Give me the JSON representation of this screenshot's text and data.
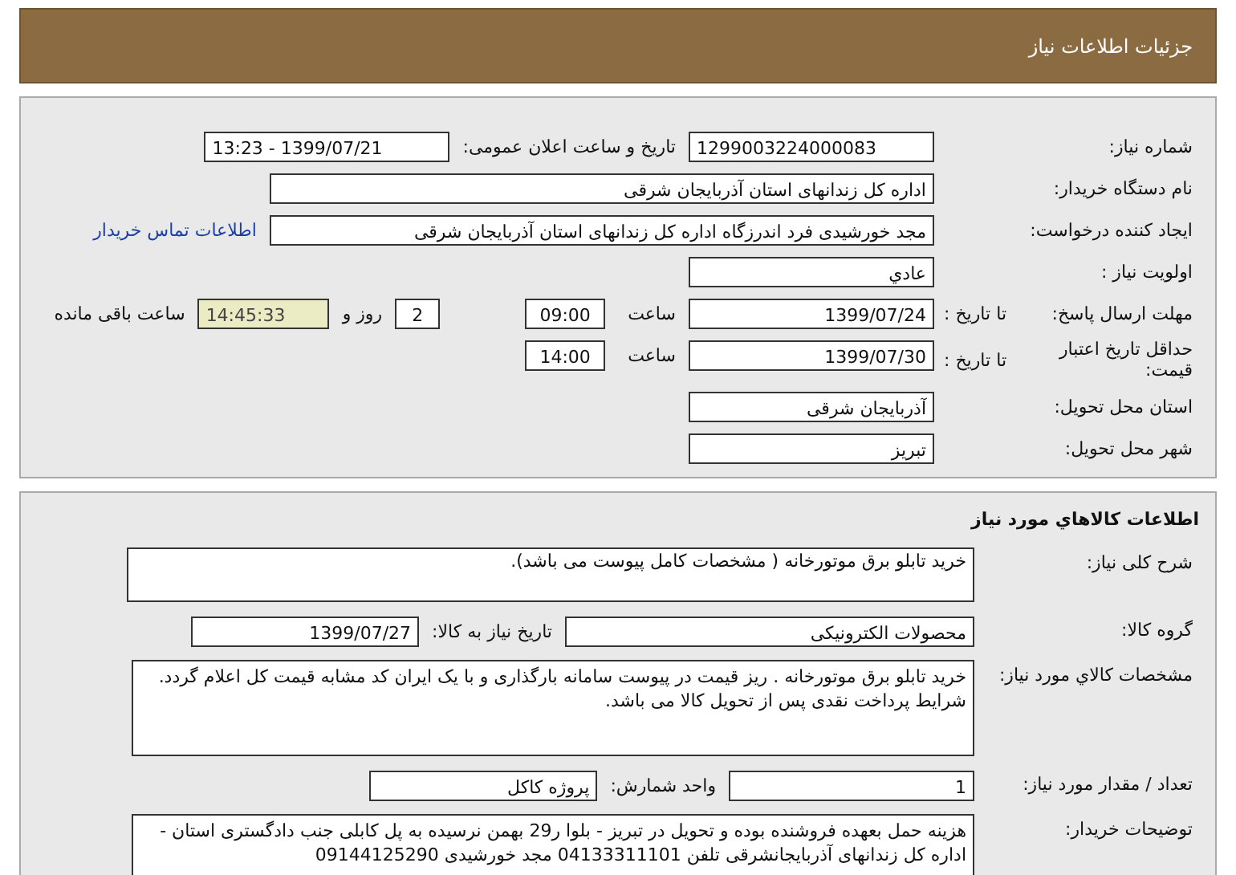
{
  "title": "جزئیات اطلاعات نیاز",
  "sections": [
    {
      "rows": [
        {
          "label": "شماره نیاز:",
          "items": [
            {
              "kind": "field",
              "value": "1299003224000083"
            },
            {
              "kind": "text",
              "value": "تاریخ و ساعت اعلان عمومی:"
            },
            {
              "kind": "field",
              "value": "1399/07/21 - 13:23"
            }
          ]
        },
        {
          "label": "نام دستگاه خریدار:",
          "items": [
            {
              "kind": "wide",
              "value": "اداره کل زندانهای استان آذربایجان شرقی"
            }
          ]
        },
        {
          "label": "ایجاد کننده درخواست:",
          "items": [
            {
              "kind": "wide",
              "value": "مجد خورشیدی فرد اندرزگاه اداره کل زندانهای استان آذربایجان شرقی"
            },
            {
              "kind": "link",
              "value": "اطلاعات تماس خریدار"
            }
          ]
        },
        {
          "label": "اولویت نیاز :",
          "items": [
            {
              "kind": "field",
              "value": "عادي"
            }
          ]
        },
        {
          "label": "مهلت ارسال پاسخ:",
          "sublabel": "تا تاریخ :",
          "items": [
            {
              "kind": "field",
              "value": "1399/07/24"
            },
            {
              "kind": "text",
              "value": "ساعت"
            },
            {
              "kind": "time",
              "value": "09:00"
            },
            {
              "kind": "count",
              "value": "2"
            },
            {
              "kind": "text",
              "value": "روز و"
            },
            {
              "kind": "timer",
              "value": "14:45:33"
            },
            {
              "kind": "text",
              "value": "ساعت باقی مانده"
            }
          ]
        },
        {
          "label": "حداقل تاریخ اعتبار قیمت:",
          "sublabel": "تا تاریخ :",
          "items": [
            {
              "kind": "field",
              "value": "1399/07/30"
            },
            {
              "kind": "text",
              "value": "ساعت"
            },
            {
              "kind": "time",
              "value": "14:00"
            }
          ]
        },
        {
          "label": "استان محل تحویل:",
          "items": [
            {
              "kind": "field",
              "value": "آذربایجان شرقی"
            }
          ]
        },
        {
          "label": "شهر محل تحویل:",
          "items": [
            {
              "kind": "field",
              "value": "تبریز"
            }
          ]
        }
      ]
    },
    {
      "heading": "اطلاعات کالاهاي مورد نیاز",
      "rows": [
        {
          "label": "شرح کلی نیاز:",
          "items": [
            {
              "kind": "note",
              "value": "خرید تابلو برق موتورخانه ( مشخصات کامل پیوست می باشد)."
            }
          ]
        },
        {
          "label": "گروه کالا:",
          "items": [
            {
              "kind": "field2",
              "value": "محصولات الکترونیکی"
            },
            {
              "kind": "text",
              "value": "تاریخ نیاز به کالا:"
            },
            {
              "kind": "field3",
              "value": "1399/07/27"
            }
          ]
        },
        {
          "label": "مشخصات کالاي مورد نیاز:",
          "items": [
            {
              "kind": "area",
              "value": "خرید تابلو برق موتورخانه . ریز قیمت در پیوست سامانه بارگذاری و با یک ایران کد مشابه قیمت کل اعلام گردد. شرایط پرداخت نقدی پس از تحویل کالا می باشد."
            }
          ]
        },
        {
          "label": "تعداد / مقدار مورد نیاز:",
          "items": [
            {
              "kind": "field",
              "value": "1"
            },
            {
              "kind": "text",
              "value": "واحد شمارش:"
            },
            {
              "kind": "field3",
              "value": "پروژه کاکل"
            }
          ]
        },
        {
          "label": "توضیحات خریدار:",
          "items": [
            {
              "kind": "area",
              "value": "هزینه حمل بعهده فروشنده بوده و تحویل در تبریز - بلوا ر29 بهمن نرسیده به پل کابلی جنب دادگستری استان - اداره کل زندانهای آذربایجانشرقی تلفن 04133311101 مجد خورشیدی 09144125290"
            }
          ]
        }
      ]
    }
  ]
}
